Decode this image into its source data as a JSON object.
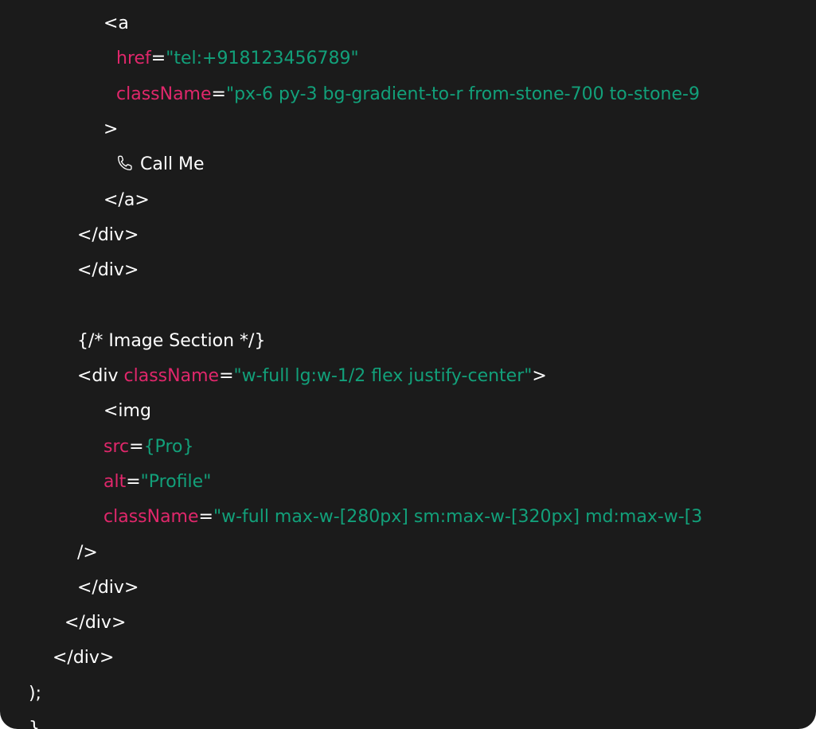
{
  "colors": {
    "background": "#1b1b1b",
    "text": "#ffffff",
    "attribute": "#e0276b",
    "string": "#12a07a"
  },
  "code": {
    "lines": [
      {
        "indent": 4,
        "tokens": [
          {
            "t": "text",
            "v": "<a"
          }
        ]
      },
      {
        "indent": 5,
        "tokens": [
          {
            "t": "attr",
            "v": "href"
          },
          {
            "t": "text",
            "v": "="
          },
          {
            "t": "str",
            "v": "\"tel:+918123456789\""
          }
        ]
      },
      {
        "indent": 5,
        "tokens": [
          {
            "t": "attr",
            "v": "className"
          },
          {
            "t": "text",
            "v": "="
          },
          {
            "t": "str",
            "v": "\"px-6 py-3 bg-gradient-to-r from-stone-700 to-stone-9"
          }
        ]
      },
      {
        "indent": 4,
        "tokens": [
          {
            "t": "text",
            "v": ">"
          }
        ]
      },
      {
        "indent": 5,
        "icon": "phone-icon",
        "tokens": [
          {
            "t": "text",
            "v": "Call Me"
          }
        ]
      },
      {
        "indent": 4,
        "tokens": [
          {
            "t": "text",
            "v": "</a>"
          }
        ]
      },
      {
        "indent": 3,
        "tokens": [
          {
            "t": "text",
            "v": "</div>"
          }
        ]
      },
      {
        "indent": 3,
        "tokens": [
          {
            "t": "text",
            "v": "</div>"
          }
        ]
      },
      {
        "indent": 0,
        "tokens": []
      },
      {
        "indent": 3,
        "tokens": [
          {
            "t": "text",
            "v": "{/* Image Section */}"
          }
        ]
      },
      {
        "indent": 3,
        "tokens": [
          {
            "t": "text",
            "v": "<div "
          },
          {
            "t": "attr",
            "v": "className"
          },
          {
            "t": "text",
            "v": "="
          },
          {
            "t": "str",
            "v": "\"w-full lg:w-1/2 flex justify-center\""
          },
          {
            "t": "text",
            "v": ">"
          }
        ]
      },
      {
        "indent": 4,
        "tokens": [
          {
            "t": "text",
            "v": "<img"
          }
        ]
      },
      {
        "indent": 4,
        "tokens": [
          {
            "t": "attr",
            "v": "src"
          },
          {
            "t": "text",
            "v": "="
          },
          {
            "t": "str",
            "v": "{Pro}"
          }
        ]
      },
      {
        "indent": 4,
        "tokens": [
          {
            "t": "attr",
            "v": "alt"
          },
          {
            "t": "text",
            "v": "="
          },
          {
            "t": "str",
            "v": "\"Profile\""
          }
        ]
      },
      {
        "indent": 4,
        "tokens": [
          {
            "t": "attr",
            "v": "className"
          },
          {
            "t": "text",
            "v": "="
          },
          {
            "t": "str",
            "v": "\"w-full max-w-[280px] sm:max-w-[320px] md:max-w-[3"
          }
        ]
      },
      {
        "indent": 3,
        "tokens": [
          {
            "t": "text",
            "v": "/>"
          }
        ]
      },
      {
        "indent": 3,
        "tokens": [
          {
            "t": "text",
            "v": "</div>"
          }
        ]
      },
      {
        "indent": 2,
        "tokens": [
          {
            "t": "text",
            "v": "</div>"
          }
        ]
      },
      {
        "indent": 1,
        "tokens": [
          {
            "t": "text",
            "v": "</div>"
          }
        ]
      },
      {
        "indent": 0,
        "tokens": [
          {
            "t": "text",
            "v": ");"
          }
        ]
      },
      {
        "indent": 0,
        "tokens": [
          {
            "t": "text",
            "v": "}"
          }
        ]
      }
    ]
  }
}
